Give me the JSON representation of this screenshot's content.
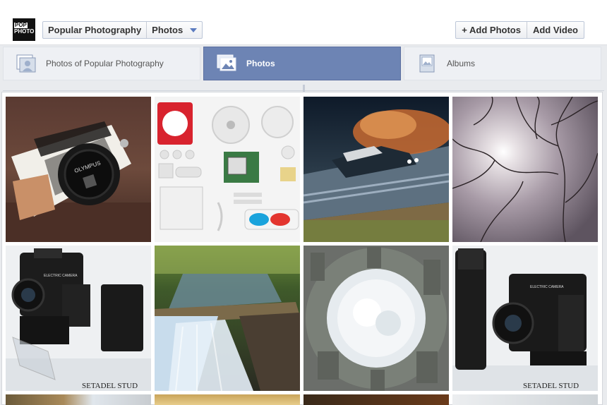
{
  "page": {
    "logo_text": [
      "POP",
      "PHOTO"
    ],
    "breadcrumb": {
      "page_name": "Popular Photography",
      "section": "Photos"
    },
    "actions": {
      "add_photos": "+ Add Photos",
      "add_video": "Add Video"
    }
  },
  "tabs": [
    {
      "label": "Photos of Popular Photography",
      "active": false,
      "icon": "tagged-photos-icon"
    },
    {
      "label": "Photos",
      "active": true,
      "icon": "photos-icon"
    },
    {
      "label": "Albums",
      "active": false,
      "icon": "albums-icon"
    }
  ],
  "photos": [
    {
      "name": "olympus-pen-camera"
    },
    {
      "name": "camera-parts-flatlay"
    },
    {
      "name": "racecar-dust"
    },
    {
      "name": "sun-through-branches"
    },
    {
      "name": "hasselblad-electric-camera"
    },
    {
      "name": "waterfall-stream"
    },
    {
      "name": "tiny-planet-city"
    },
    {
      "name": "hasselblad-camera-side"
    }
  ],
  "watermarks": {
    "photo5": "SETADEL STUD",
    "photo8": "SETADEL STUD"
  },
  "colors": {
    "active_tab": "#6d84b4",
    "tab_bg": "#eef0f4",
    "page_bg": "#e9ebee"
  }
}
